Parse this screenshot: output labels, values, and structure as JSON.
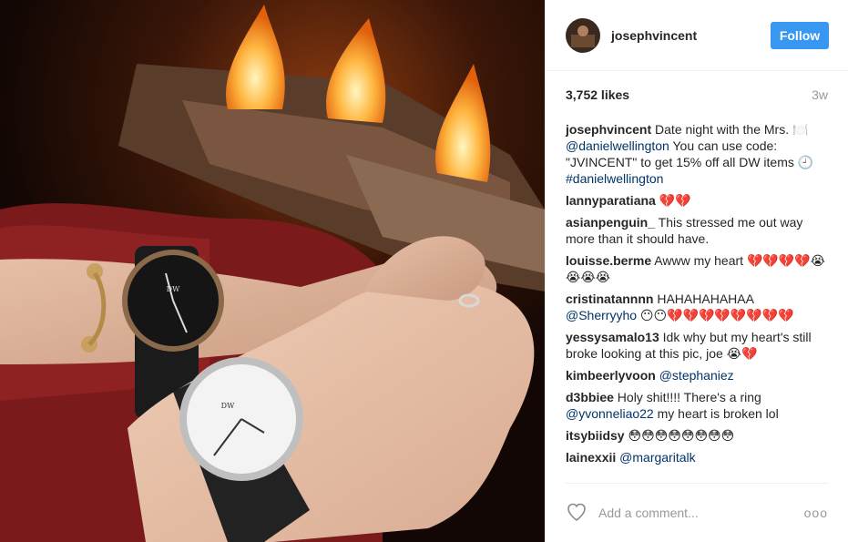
{
  "post": {
    "username": "josephvincent",
    "follow_label": "Follow",
    "likes": "3,752 likes",
    "time_ago": "3w"
  },
  "caption": {
    "user": "josephvincent",
    "text_1": "Date night with the Mrs. 🍽️",
    "mention": "@danielwellington",
    "text_2": "You can use code: \"JVINCENT\" to get 15% off all DW items 🕘",
    "hashtag": "#danielwellington"
  },
  "comments": [
    {
      "user": "lannyparatiana",
      "text": "💔💔"
    },
    {
      "user": "asianpenguin_",
      "text": "This stressed me out way more than it should have."
    },
    {
      "user": "louisse.berme",
      "text": "Awww my heart 💔💔💔💔😭😭😭😭"
    },
    {
      "user": "cristinatannnn",
      "text": "HAHAHAHAHAA",
      "mention": "@Sherryyho",
      "text_after": "😶😶💔💔💔💔💔💔💔💔"
    },
    {
      "user": "yessysamalo13",
      "text": "Idk why but my heart's still broke looking at this pic, joe 😭💔"
    },
    {
      "user": "kimbeerlyvoon",
      "mention": "@stephaniez"
    },
    {
      "user": "d3bbiee",
      "text": "Holy shit!!!! There's a ring",
      "mention": "@yvonneliao22",
      "text_after": "my heart is broken lol"
    },
    {
      "user": "itsybiidsy",
      "text": "😳😳😳😳😳😳😳😳"
    },
    {
      "user": "lainexxii",
      "mention": "@margaritalk"
    }
  ],
  "add_comment": {
    "placeholder": "Add a comment..."
  },
  "more_label": "ooo",
  "icons": {
    "like": "heart-icon",
    "more": "more-options-icon"
  }
}
